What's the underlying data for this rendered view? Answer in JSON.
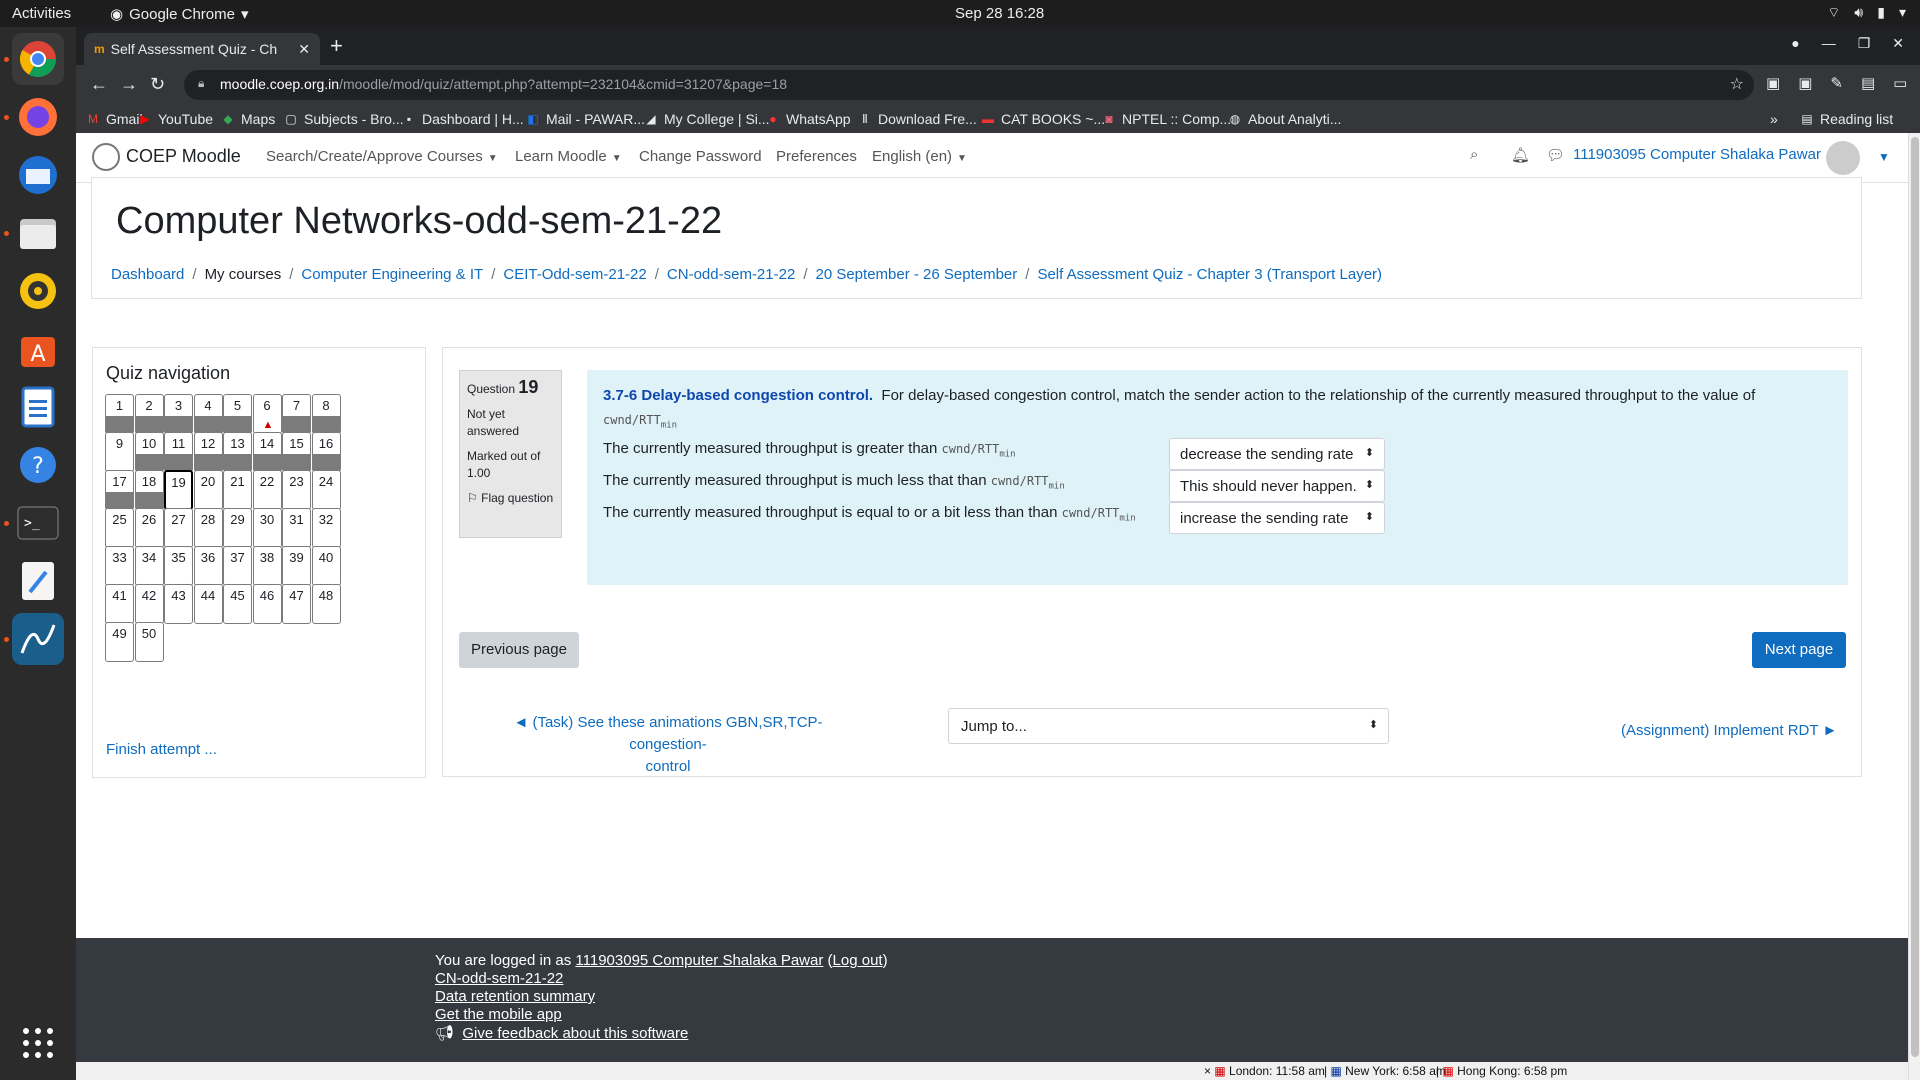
{
  "system": {
    "activities": "Activities",
    "app_name": "Google Chrome",
    "clock": "Sep 28  16:28"
  },
  "browser": {
    "tab_title": "Self Assessment Quiz - Ch",
    "url_host": "moodle.coep.org.in",
    "url_path": "/moodle/mod/quiz/attempt.php?attempt=232104&cmid=31207&page=18",
    "bookmarks": [
      "Gmail",
      "YouTube",
      "Maps",
      "Subjects - Bro...",
      "Dashboard | H...",
      "Mail - PAWAR...",
      "My College | Si...",
      "WhatsApp",
      "Download Fre...",
      "CAT BOOKS ~...",
      "NPTEL :: Comp...",
      "About Analyti..."
    ],
    "more": "»",
    "reading_list": "Reading list"
  },
  "moodle_nav": {
    "brand": "COEP Moodle",
    "items": [
      "Search/Create/Approve Courses",
      "Learn Moodle",
      "Change Password",
      "Preferences",
      "English (en)"
    ],
    "user": "111903095 Computer Shalaka Pawar"
  },
  "course": {
    "title": "Computer Networks-odd-sem-21-22",
    "breadcrumbs": [
      "Dashboard",
      "My courses",
      "Computer Engineering & IT",
      "CEIT-Odd-sem-21-22",
      "CN-odd-sem-21-22",
      "20 September - 26 September",
      "Self Assessment Quiz - Chapter 3 (Transport Layer)"
    ]
  },
  "quiz_nav": {
    "title": "Quiz navigation",
    "numbers": [
      "1",
      "2",
      "3",
      "4",
      "5",
      "6",
      "7",
      "8",
      "9",
      "10",
      "11",
      "12",
      "13",
      "14",
      "15",
      "16",
      "17",
      "18",
      "19",
      "20",
      "21",
      "22",
      "23",
      "24",
      "25",
      "26",
      "27",
      "28",
      "29",
      "30",
      "31",
      "32",
      "33",
      "34",
      "35",
      "36",
      "37",
      "38",
      "39",
      "40",
      "41",
      "42",
      "43",
      "44",
      "45",
      "46",
      "47",
      "48",
      "49",
      "50"
    ],
    "finish": "Finish attempt ..."
  },
  "question": {
    "label": "Question",
    "number": "19",
    "status": "Not yet answered",
    "marks": "Marked out of 1.00",
    "flag": "Flag question",
    "heading": "3.7-6 Delay-based congestion control.",
    "text": "For delay-based congestion control, match the sender action to the relationship  of the currently measured throughput to the value of",
    "formula": "cwnd/RTT",
    "formula_sub": "min",
    "rows": [
      {
        "text": "The currently measured throughput is greater than",
        "answer": "decrease the sending rate"
      },
      {
        "text": "The currently measured throughput is much less that than",
        "answer": "This should never happen."
      },
      {
        "text": "The currently measured throughput is equal to or a bit less than than",
        "answer": "increase the sending rate"
      }
    ]
  },
  "actions": {
    "previous": "Previous page",
    "next": "Next page",
    "prev_activity_line1": "◄ (Task) See these animations GBN,SR,TCP-congestion-",
    "prev_activity_line2": "control",
    "jump": "Jump to...",
    "next_activity": "(Assignment) Implement RDT ►"
  },
  "footer": {
    "logged_in": "You are logged in as",
    "user": "111903095 Computer Shalaka Pawar",
    "logout": "Log out",
    "course_link": "CN-odd-sem-21-22",
    "data_retention": "Data retention summary",
    "mobile_app": "Get the mobile app",
    "feedback": "Give feedback about this software"
  },
  "world_clock": [
    "London: 11:58 am",
    "New York: 6:58 am",
    "Hong Kong: 6:58 pm"
  ]
}
